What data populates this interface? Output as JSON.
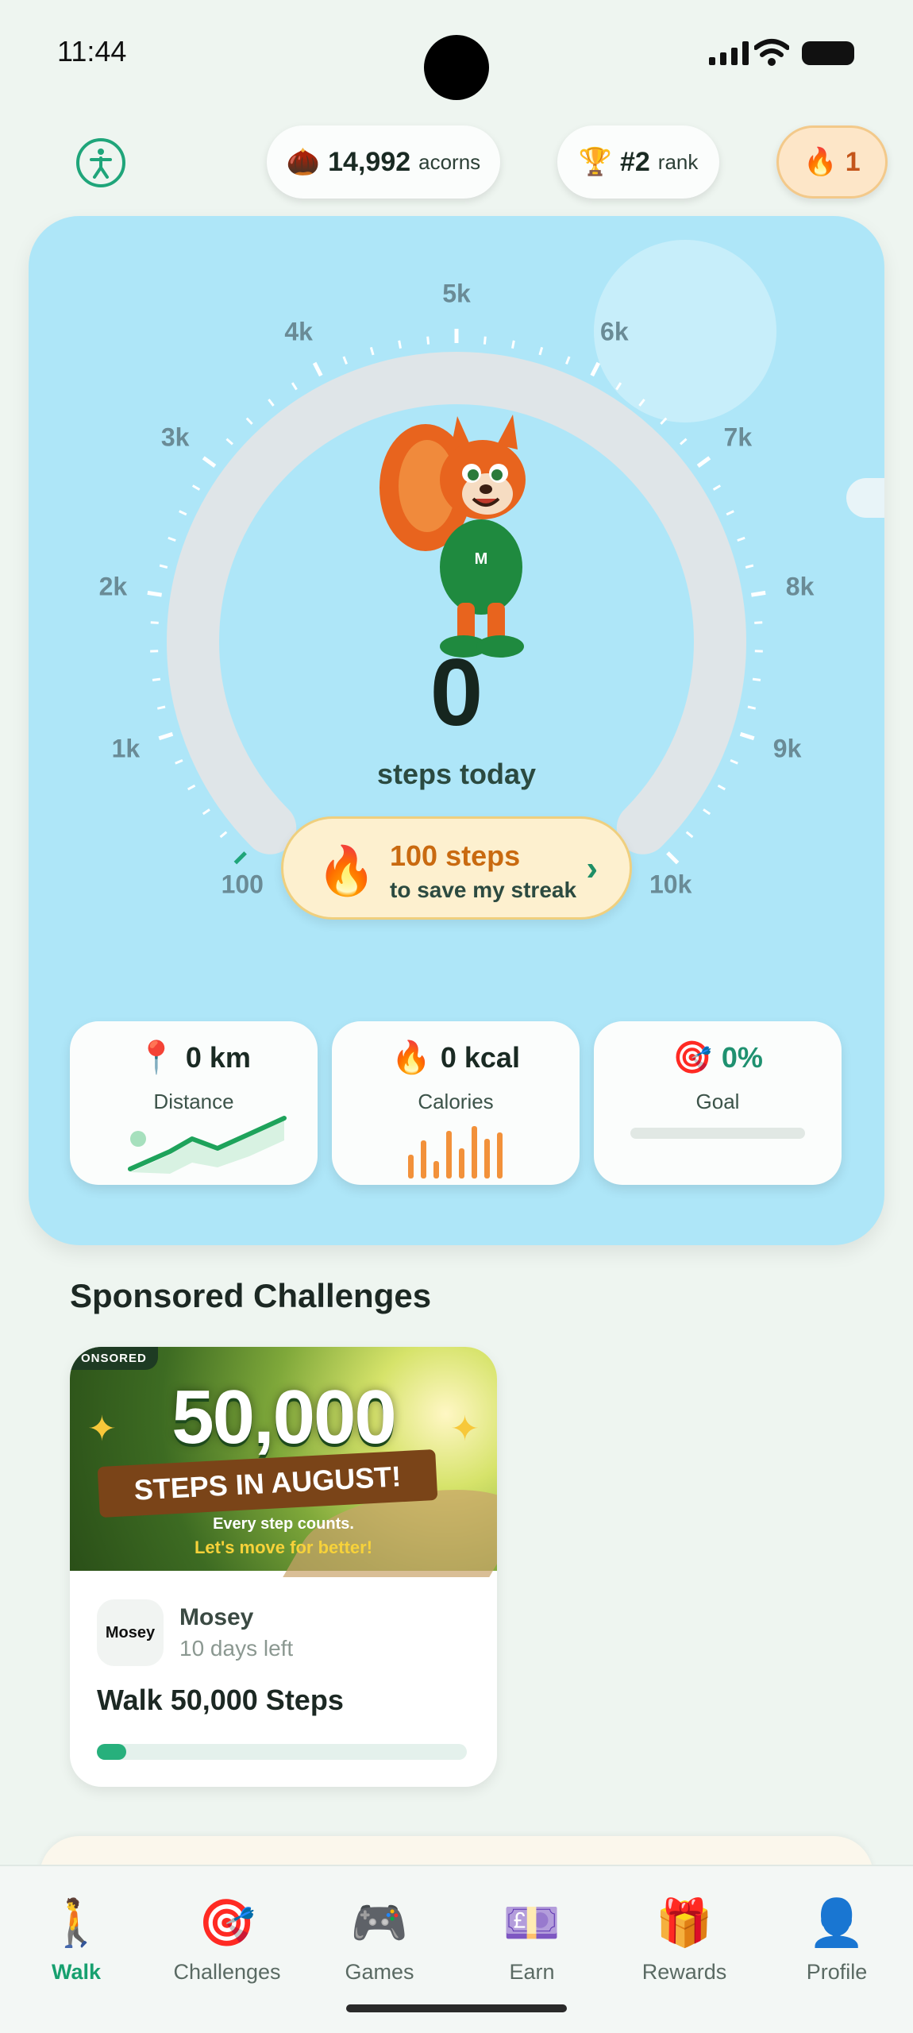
{
  "status_bar": {
    "time": "11:44"
  },
  "top_bar": {
    "acorns": {
      "value": "14,992",
      "unit": "acorns",
      "icon": "acorn-icon"
    },
    "rank": {
      "value": "#2",
      "unit": "rank",
      "icon": "trophy-icon"
    },
    "streak": {
      "value": "1",
      "icon": "fire-icon"
    }
  },
  "gauge": {
    "tick_labels": [
      "100",
      "1k",
      "2k",
      "3k",
      "4k",
      "5k",
      "6k",
      "7k",
      "8k",
      "9k",
      "10k"
    ],
    "min": 0,
    "max": 10000,
    "current": 0
  },
  "steps": {
    "count": "0",
    "label": "steps today"
  },
  "streak_save": {
    "title": "100 steps",
    "subtitle": "to save my streak",
    "chevron": "›"
  },
  "stats": {
    "distance": {
      "value": "0 km",
      "label": "Distance",
      "icon": "pin-icon"
    },
    "calories": {
      "value": "0 kcal",
      "label": "Calories",
      "icon": "fire-icon"
    },
    "goal": {
      "value": "0%",
      "label": "Goal",
      "icon": "target-icon",
      "progress": 0
    }
  },
  "sponsored": {
    "section_title": "Sponsored Challenges",
    "challenge": {
      "badge": "ONSORED",
      "banner_number": "50,000",
      "banner_ribbon": "STEPS IN AUGUST!",
      "banner_tagline_1": "Every step counts.",
      "banner_tagline_2": "Let's move for better!",
      "brand_logo": "Mosey",
      "brand_name": "Mosey",
      "days_left": "10 days left",
      "name": "Walk 50,000 Steps",
      "progress": 0.08
    }
  },
  "nav": [
    {
      "label": "Walk",
      "icon": "🚶",
      "active": true
    },
    {
      "label": "Challenges",
      "icon": "🎯",
      "active": false
    },
    {
      "label": "Games",
      "icon": "🎮",
      "active": false
    },
    {
      "label": "Earn",
      "icon": "💷",
      "active": false
    },
    {
      "label": "Rewards",
      "icon": "🎁",
      "active": false
    },
    {
      "label": "Profile",
      "icon": "👤",
      "active": false
    }
  ],
  "colors": {
    "accent": "#1fa57a",
    "card_sky": "#aee6f8",
    "streak_orange": "#c96a10"
  }
}
